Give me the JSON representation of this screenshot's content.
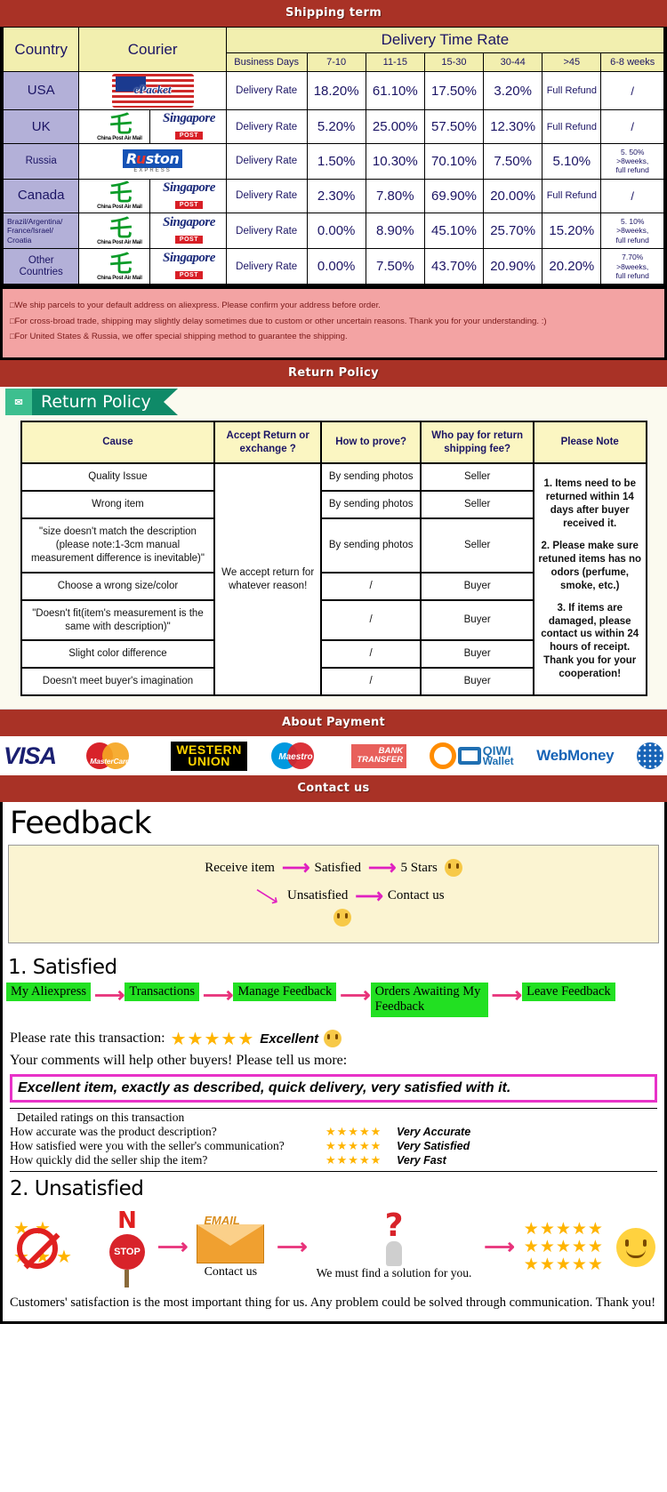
{
  "banners": {
    "shipping": "Shipping term",
    "return": "Return Policy",
    "payment": "About Payment",
    "contact": "Contact us"
  },
  "shipping_table": {
    "headers": {
      "country": "Country",
      "courier": "Courier",
      "delivery_time_rate": "Delivery Time Rate",
      "business_days": "Business Days",
      "ranges": [
        "7-10",
        "11-15",
        "15-30",
        "30-44",
        ">45",
        "6-8 weeks"
      ]
    },
    "rate_label": "Delivery Rate",
    "rows": [
      {
        "country": "USA",
        "couriers": [
          "epacket"
        ],
        "values": [
          "18.20%",
          "61.10%",
          "17.50%",
          "3.20%",
          "Full Refund",
          "/"
        ]
      },
      {
        "country": "UK",
        "couriers": [
          "china-post-air-mail",
          "singapore-post"
        ],
        "values": [
          "5.20%",
          "25.00%",
          "57.50%",
          "12.30%",
          "Full Refund",
          "/"
        ]
      },
      {
        "country": "Russia",
        "couriers": [
          "ruston-express"
        ],
        "values": [
          "1.50%",
          "10.30%",
          "70.10%",
          "7.50%",
          "5.10%",
          "5. 50%\n>8weeks,\nfull refund"
        ]
      },
      {
        "country": "Canada",
        "couriers": [
          "china-post-air-mail",
          "singapore-post"
        ],
        "values": [
          "2.30%",
          "7.80%",
          "69.90%",
          "20.00%",
          "Full Refund",
          "/"
        ]
      },
      {
        "country": "Brazil/Argentina/\nFrance/Israel/\nCroatia",
        "couriers": [
          "china-post-air-mail",
          "singapore-post"
        ],
        "values": [
          "0.00%",
          "8.90%",
          "45.10%",
          "25.70%",
          "15.20%",
          "5. 10%\n>8weeks,\nfull refund"
        ]
      },
      {
        "country": "Other Countries",
        "couriers": [
          "china-post-air-mail",
          "singapore-post"
        ],
        "values": [
          "0.00%",
          "7.50%",
          "43.70%",
          "20.90%",
          "20.20%",
          "7.70%\n>8weeks,\nfull refund"
        ]
      }
    ],
    "notes": [
      "We ship parcels to your default address on aliexpress. Please confirm your address before order.",
      "For cross-broad trade, shipping may slightly delay sometimes due to custom or other uncertain reasons. Thank you for your understanding. :)",
      "For United States & Russia, we offer special shipping method to guarantee the shipping."
    ]
  },
  "courier_logos": {
    "epacket": "ePacket",
    "china_post_mark": "China Post Air Mail",
    "singapore_post_word": "Singapore",
    "singapore_post_badge": "POST",
    "ruston": "Ruston",
    "ruston_sub": "EXPRESS"
  },
  "return_policy": {
    "tag_label": "Return Policy",
    "tag_icon": "mail-icon",
    "headers": [
      "Cause",
      "Accept Return or exchange ?",
      "How to prove?",
      "Who pay for return shipping fee?",
      "Please Note"
    ],
    "accept_text": "We accept return for whatever reason!",
    "rows": [
      {
        "cause": "Quality Issue",
        "prove": "By sending photos",
        "who": "Seller"
      },
      {
        "cause": "Wrong item",
        "prove": "By sending photos",
        "who": "Seller"
      },
      {
        "cause": "\"size doesn't match the description (please note:1-3cm manual measurement difference is inevitable)\"",
        "prove": "By sending photos",
        "who": "Seller"
      },
      {
        "cause": "Choose a wrong size/color",
        "prove": "/",
        "who": "Buyer"
      },
      {
        "cause": "\"Doesn't fit(item's measurement is the same with description)\"",
        "prove": "/",
        "who": "Buyer"
      },
      {
        "cause": "Slight color difference",
        "prove": "/",
        "who": "Buyer"
      },
      {
        "cause": "Doesn't meet buyer's imagination",
        "prove": "/",
        "who": "Buyer"
      }
    ],
    "notes": [
      "1. Items need to be returned within 14 days after buyer received it.",
      "2. Please make sure retuned items has no odors (perfume, smoke, etc.)",
      "3. If items are damaged, please contact us within 24 hours of receipt.",
      "Thank you for your cooperation!"
    ]
  },
  "payment_logos": [
    {
      "name": "visa-logo",
      "label": "VISA"
    },
    {
      "name": "mastercard-logo",
      "label": "MasterCard"
    },
    {
      "name": "western-union-logo",
      "line1": "WESTERN",
      "line2": "UNION"
    },
    {
      "name": "maestro-logo",
      "label": "Maestro"
    },
    {
      "name": "bank-transfer-logo",
      "line1": "BANK",
      "line2": "TRANSFER"
    },
    {
      "name": "qiwi-wallet-logo",
      "line1": "QIWI",
      "line2": "Wallet"
    },
    {
      "name": "webmoney-logo",
      "label": "WebMoney"
    }
  ],
  "feedback": {
    "title": "Feedback",
    "flow": {
      "start": "Receive item",
      "satisfied": "Satisfied",
      "stars": "5 Stars",
      "unsatisfied": "Unsatisfied",
      "contact": "Contact us"
    },
    "satisfied_heading": "1. Satisfied",
    "steps": [
      "My Aliexpress",
      "Transactions",
      "Manage Feedback",
      "Orders Awaiting My Feedback",
      "Leave Feedback"
    ],
    "rate_prompt": "Please rate this transaction:",
    "stars_glyph": "★★★★★",
    "excellent": "Excellent",
    "tell_more": "Your comments will help other buyers! Please tell us more:",
    "comment": "Excellent item, exactly as described, quick delivery, very satisfied with it.",
    "detailed_heading": "Detailed ratings on this transaction",
    "detailed_rows": [
      {
        "question": "How accurate was the product description?",
        "stars": "★★★★★",
        "value": "Very Accurate"
      },
      {
        "question": "How satisfied were you with the seller's communication?",
        "stars": "★★★★★",
        "value": "Very Satisfied"
      },
      {
        "question": "How quickly did the seller ship the item?",
        "stars": "★★★★★",
        "value": "Very Fast"
      }
    ],
    "unsatisfied_heading": "2. Unsatisfied",
    "unsat_icons": {
      "no_stars": "no-low-rating-icon",
      "stop_letter": "N",
      "stop_sign": "STOP",
      "email": "EMAIL",
      "contact_caption": "Contact us",
      "solution_caption": "We must find a solution for you.",
      "good_stars": "★★★★★"
    },
    "closing": "Customers' satisfaction is the most important thing for us. Any problem could be solved through communication. Thank you!"
  }
}
